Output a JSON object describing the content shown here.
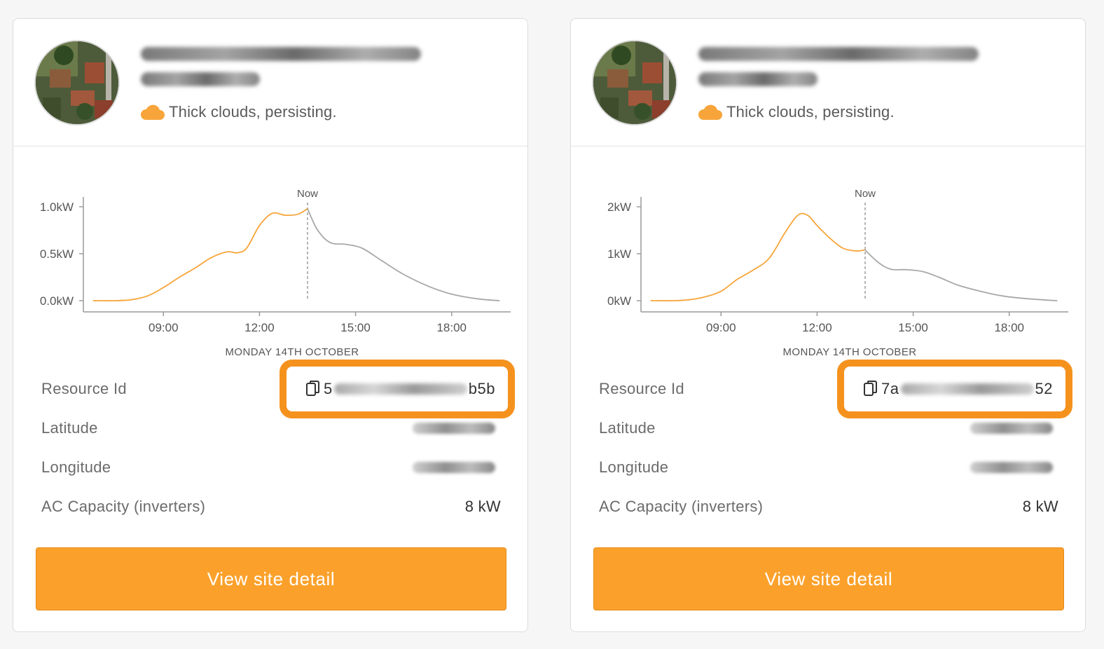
{
  "cards": [
    {
      "name_line2_hint": "(",
      "weather": {
        "icon": "cloud-icon",
        "text": "Thick clouds, persisting."
      },
      "chart_data": {
        "type": "line",
        "xlabel": "MONDAY 14TH OCTOBER",
        "now_label": "Now",
        "x_ticks": [
          "09:00",
          "12:00",
          "15:00",
          "18:00"
        ],
        "y_ticks": [
          "0.0kW",
          "0.5kW",
          "1.0kW"
        ],
        "ylim": [
          0,
          1.0
        ],
        "xlim_hours": [
          6.5,
          19.8
        ],
        "now_hour": 13.5,
        "series": [
          {
            "role": "actual",
            "color": "#f7a53a",
            "x_hours": [
              6.8,
              7.5,
              8.0,
              8.5,
              9.0,
              9.5,
              10.0,
              10.5,
              11.0,
              11.3,
              11.6,
              12.0,
              12.4,
              12.8,
              13.2,
              13.5
            ],
            "y_kw": [
              0.0,
              0.0,
              0.01,
              0.05,
              0.14,
              0.25,
              0.35,
              0.46,
              0.52,
              0.51,
              0.56,
              0.8,
              0.93,
              0.91,
              0.92,
              0.98
            ]
          },
          {
            "role": "forecast",
            "color": "#a8a8a8",
            "x_hours": [
              13.5,
              13.8,
              14.2,
              14.7,
              15.2,
              15.8,
              16.5,
              17.3,
              18.0,
              18.8,
              19.5
            ],
            "y_kw": [
              0.98,
              0.76,
              0.62,
              0.6,
              0.56,
              0.43,
              0.28,
              0.15,
              0.07,
              0.02,
              0.0
            ]
          }
        ]
      },
      "info": {
        "resource_label": "Resource Id",
        "resource_id_start": "5",
        "resource_id_end": "b5b",
        "latitude_label": "Latitude",
        "longitude_label": "Longitude",
        "ac_label": "AC Capacity (inverters)",
        "ac_value": "8 kW"
      },
      "button_label": "View site detail"
    },
    {
      "name_line2_hint": "(",
      "weather": {
        "icon": "cloud-icon",
        "text": "Thick clouds, persisting."
      },
      "chart_data": {
        "type": "line",
        "xlabel": "MONDAY 14TH OCTOBER",
        "now_label": "Now",
        "x_ticks": [
          "09:00",
          "12:00",
          "15:00",
          "18:00"
        ],
        "y_ticks": [
          "0kW",
          "1kW",
          "2kW"
        ],
        "ylim": [
          0,
          2.0
        ],
        "xlim_hours": [
          6.5,
          19.8
        ],
        "now_hour": 13.5,
        "series": [
          {
            "role": "actual",
            "color": "#f7a53a",
            "x_hours": [
              6.8,
              7.5,
              8.0,
              8.5,
              9.0,
              9.5,
              10.0,
              10.5,
              11.0,
              11.4,
              11.7,
              12.0,
              12.4,
              12.8,
              13.2,
              13.5
            ],
            "y_kw": [
              0.0,
              0.0,
              0.02,
              0.08,
              0.2,
              0.45,
              0.65,
              0.9,
              1.45,
              1.82,
              1.82,
              1.6,
              1.33,
              1.12,
              1.06,
              1.08
            ]
          },
          {
            "role": "forecast",
            "color": "#a8a8a8",
            "x_hours": [
              13.5,
              13.9,
              14.3,
              14.8,
              15.3,
              15.8,
              16.4,
              17.1,
              17.8,
              18.6,
              19.5
            ],
            "y_kw": [
              1.08,
              0.82,
              0.67,
              0.66,
              0.62,
              0.5,
              0.33,
              0.2,
              0.1,
              0.04,
              0.0
            ]
          }
        ]
      },
      "info": {
        "resource_label": "Resource Id",
        "resource_id_start": "7a",
        "resource_id_end": "52",
        "latitude_label": "Latitude",
        "longitude_label": "Longitude",
        "ac_label": "AC Capacity (inverters)",
        "ac_value": "8 kW"
      },
      "button_label": "View site detail"
    }
  ]
}
